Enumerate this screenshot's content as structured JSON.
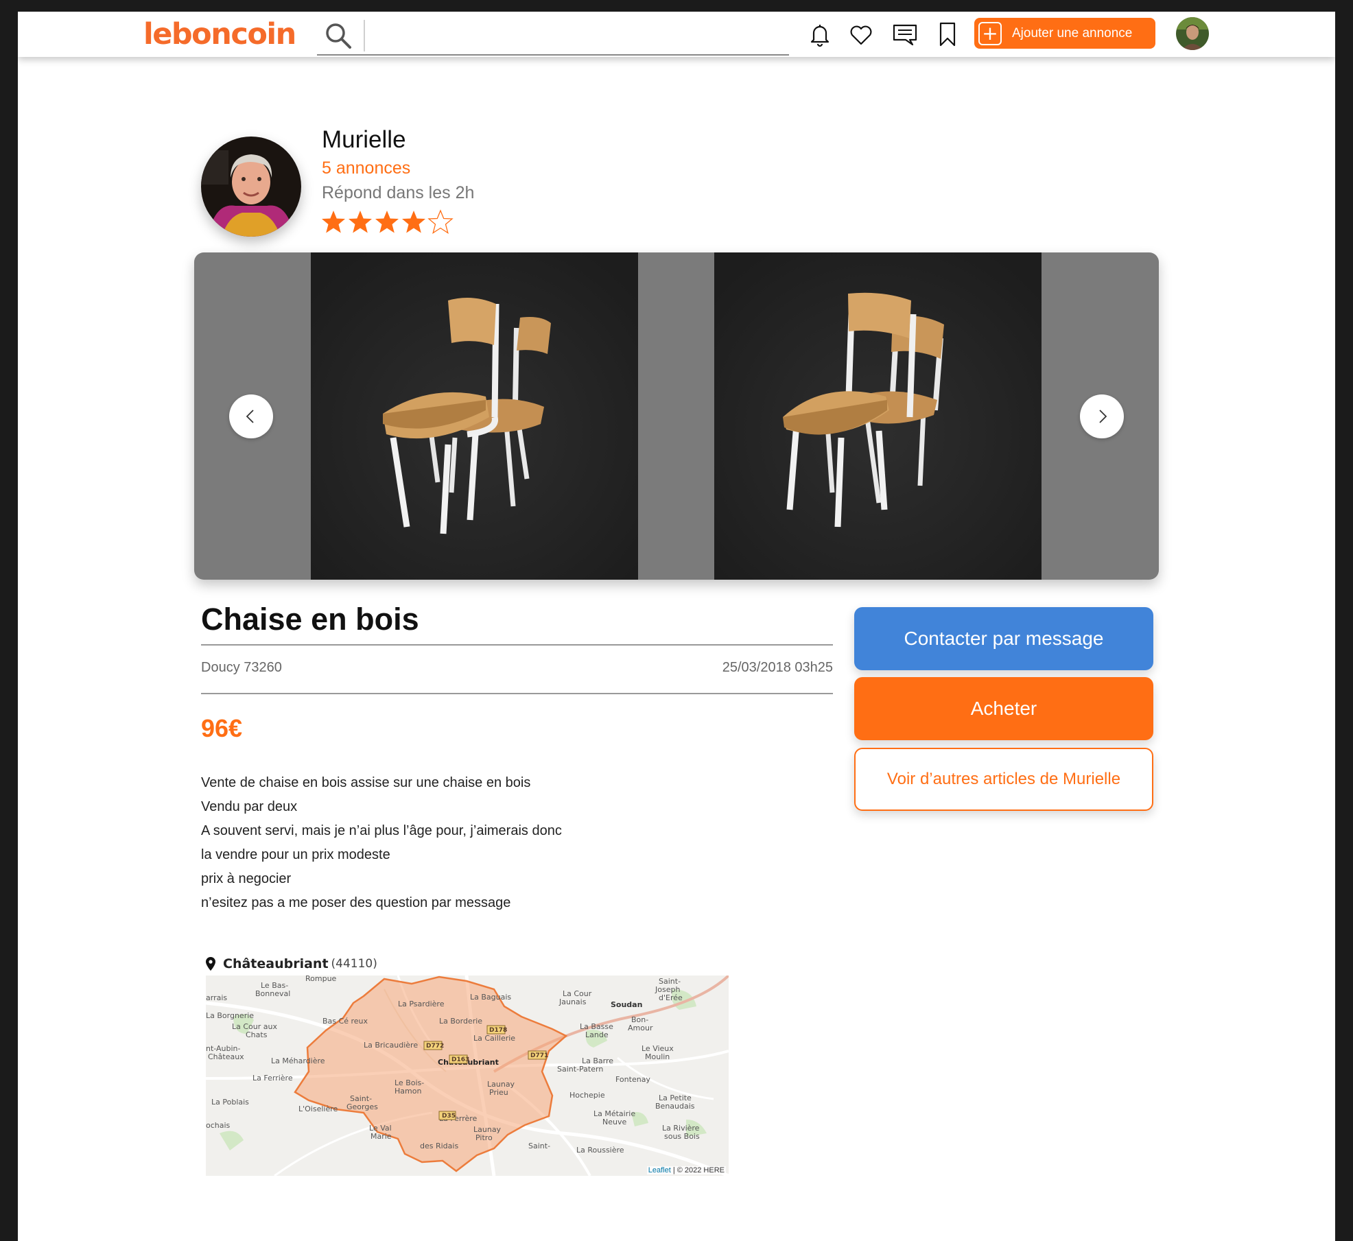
{
  "header": {
    "logo": "leboncoin",
    "search_placeholder": "",
    "add_listing_label": "Ajouter une annonce",
    "icons": [
      "search-icon",
      "bell-icon",
      "heart-icon",
      "messages-icon",
      "bookmark-icon",
      "plus-icon"
    ]
  },
  "seller": {
    "name": "Murielle",
    "listings": "5 annonces",
    "response": "Répond dans les 2h",
    "rating": 4,
    "rating_max": 5
  },
  "listing": {
    "title": "Chaise en bois",
    "location": "Doucy 73260",
    "date": "25/03/2018 03h25",
    "price": "96€",
    "description": [
      "Vente de chaise en bois assise sur une chaise en bois",
      "Vendu par deux",
      "A souvent servi, mais je n’ai plus l’âge pour, j’aimerais donc",
      "la vendre pour un prix modeste",
      "prix à negocier",
      "n’esitez pas a me poser des question par message"
    ]
  },
  "actions": {
    "contact": "Contacter par message",
    "buy": "Acheter",
    "more": "Voir d’autres articles de Murielle"
  },
  "map": {
    "city": "Châteaubriant",
    "zip": "(44110)",
    "attribution_leaflet": "Leaflet",
    "attribution_sep": " | © 2022 HERE",
    "places": [
      "Rompue",
      "Le Bas-Bonneval",
      "La Cour Jaunais",
      "Saint-Joseph d'Erée",
      "arrais",
      "La Psardière",
      "La Baguais",
      "Soudan",
      "La Borgnerie",
      "Bas Cé reux",
      "La Borderie",
      "D178",
      "Bon-Amour",
      "La Cour aux Chats",
      "La Basse Lande",
      "La Bricaudière",
      "La Caillerie",
      "D772",
      "D771",
      "nt-Aubin-Châteaux",
      "D163",
      "Le Vieux Moulin",
      "La Méhardière",
      "Châteaubriant",
      "La Barre Saint-Patern",
      "La Ferrière",
      "Fontenay",
      "Le Bois-Hamon",
      "Launay Prieu",
      "Hochepie",
      "La Poblais",
      "Saint-Georges",
      "L'Oiselière",
      "La Petite Benaudais",
      "D35",
      "La Métairie Neuve",
      "ochais",
      "Le Val Marie",
      "La Ferrère",
      "Launay Pitro",
      "La Rivière sous Bois",
      "des Ridais",
      "Saint-",
      "La Roussière"
    ]
  },
  "colors": {
    "brand_orange": "#ff6e14",
    "contact_blue": "#4184d9",
    "zone_fill": "#f6a87a",
    "zone_stroke": "#ec7c3c"
  }
}
